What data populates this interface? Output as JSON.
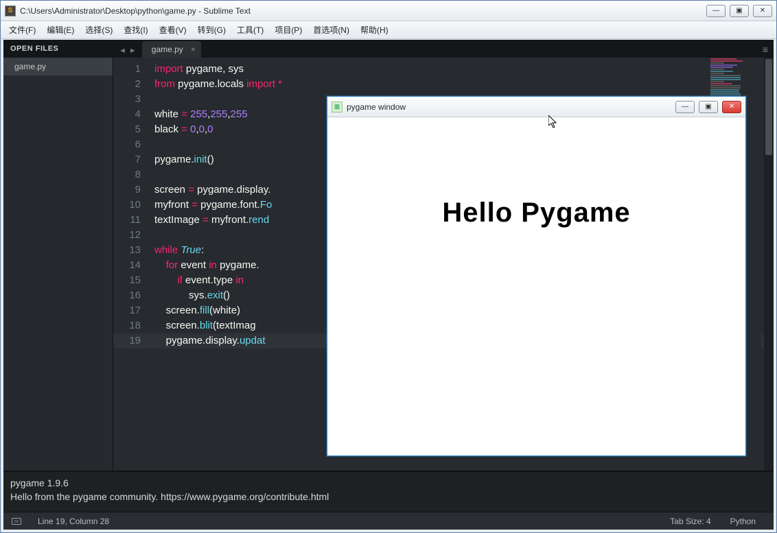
{
  "window": {
    "title": "C:\\Users\\Administrator\\Desktop\\python\\game.py - Sublime Text",
    "app_icon_letter": "S"
  },
  "menubar": [
    "文件(F)",
    "编辑(E)",
    "选择(S)",
    "查找(I)",
    "查看(V)",
    "转到(G)",
    "工具(T)",
    "项目(P)",
    "首选项(N)",
    "帮助(H)"
  ],
  "sidebar": {
    "header": "OPEN FILES",
    "items": [
      "game.py"
    ]
  },
  "tabs": [
    {
      "label": "game.py"
    }
  ],
  "code": {
    "lines": [
      {
        "n": 1,
        "tokens": [
          {
            "c": "kw",
            "t": "import"
          },
          {
            "c": "",
            "t": " pygame, sys"
          }
        ]
      },
      {
        "n": 2,
        "tokens": [
          {
            "c": "kw",
            "t": "from"
          },
          {
            "c": "",
            "t": " pygame.locals "
          },
          {
            "c": "kw",
            "t": "import"
          },
          {
            "c": "",
            "t": " "
          },
          {
            "c": "op",
            "t": "*"
          }
        ]
      },
      {
        "n": 3,
        "tokens": []
      },
      {
        "n": 4,
        "tokens": [
          {
            "c": "",
            "t": "white "
          },
          {
            "c": "op",
            "t": "="
          },
          {
            "c": "",
            "t": " "
          },
          {
            "c": "num",
            "t": "255"
          },
          {
            "c": "",
            "t": ","
          },
          {
            "c": "num",
            "t": "255"
          },
          {
            "c": "",
            "t": ","
          },
          {
            "c": "num",
            "t": "255"
          }
        ]
      },
      {
        "n": 5,
        "tokens": [
          {
            "c": "",
            "t": "black "
          },
          {
            "c": "op",
            "t": "="
          },
          {
            "c": "",
            "t": " "
          },
          {
            "c": "num",
            "t": "0"
          },
          {
            "c": "",
            "t": ","
          },
          {
            "c": "num",
            "t": "0"
          },
          {
            "c": "",
            "t": ","
          },
          {
            "c": "num",
            "t": "0"
          }
        ]
      },
      {
        "n": 6,
        "tokens": []
      },
      {
        "n": 7,
        "tokens": [
          {
            "c": "",
            "t": "pygame."
          },
          {
            "c": "fn",
            "t": "init"
          },
          {
            "c": "",
            "t": "()"
          }
        ]
      },
      {
        "n": 8,
        "tokens": []
      },
      {
        "n": 9,
        "tokens": [
          {
            "c": "",
            "t": "screen "
          },
          {
            "c": "op",
            "t": "="
          },
          {
            "c": "",
            "t": " pygame.display."
          }
        ]
      },
      {
        "n": 10,
        "tokens": [
          {
            "c": "",
            "t": "myfront "
          },
          {
            "c": "op",
            "t": "="
          },
          {
            "c": "",
            "t": " pygame.font."
          },
          {
            "c": "fn",
            "t": "Fo"
          }
        ]
      },
      {
        "n": 11,
        "tokens": [
          {
            "c": "",
            "t": "textImage "
          },
          {
            "c": "op",
            "t": "="
          },
          {
            "c": "",
            "t": " myfront."
          },
          {
            "c": "fn",
            "t": "rend"
          }
        ]
      },
      {
        "n": 12,
        "tokens": []
      },
      {
        "n": 13,
        "tokens": [
          {
            "c": "kw",
            "t": "while"
          },
          {
            "c": "",
            "t": " "
          },
          {
            "c": "kw2",
            "t": "True"
          },
          {
            "c": "",
            "t": ":"
          }
        ]
      },
      {
        "n": 14,
        "tokens": [
          {
            "c": "",
            "t": "    "
          },
          {
            "c": "kw",
            "t": "for"
          },
          {
            "c": "",
            "t": " event "
          },
          {
            "c": "kw",
            "t": "in"
          },
          {
            "c": "",
            "t": " pygame."
          }
        ]
      },
      {
        "n": 15,
        "tokens": [
          {
            "c": "",
            "t": "        "
          },
          {
            "c": "kw",
            "t": "if"
          },
          {
            "c": "",
            "t": " event.type "
          },
          {
            "c": "kw",
            "t": "in"
          }
        ]
      },
      {
        "n": 16,
        "tokens": [
          {
            "c": "",
            "t": "            sys."
          },
          {
            "c": "fn",
            "t": "exit"
          },
          {
            "c": "",
            "t": "()"
          }
        ]
      },
      {
        "n": 17,
        "tokens": [
          {
            "c": "",
            "t": "    screen."
          },
          {
            "c": "fn",
            "t": "fill"
          },
          {
            "c": "",
            "t": "(white)"
          }
        ]
      },
      {
        "n": 18,
        "tokens": [
          {
            "c": "",
            "t": "    screen."
          },
          {
            "c": "fn",
            "t": "blit"
          },
          {
            "c": "",
            "t": "(textImag"
          }
        ]
      },
      {
        "n": 19,
        "tokens": [
          {
            "c": "",
            "t": "    pygame.display."
          },
          {
            "c": "fn",
            "t": "updat"
          }
        ],
        "current": true
      }
    ]
  },
  "console": {
    "line1": "pygame 1.9.6",
    "line2": "Hello from the pygame community. https://www.pygame.org/contribute.html"
  },
  "statusbar": {
    "pos": "Line 19, Column 28",
    "tabsize": "Tab Size: 4",
    "lang": "Python"
  },
  "pygame": {
    "title": "pygame window",
    "text": "Hello Pygame"
  },
  "winbtn": {
    "min": "—",
    "max": "▣",
    "close": "✕"
  }
}
